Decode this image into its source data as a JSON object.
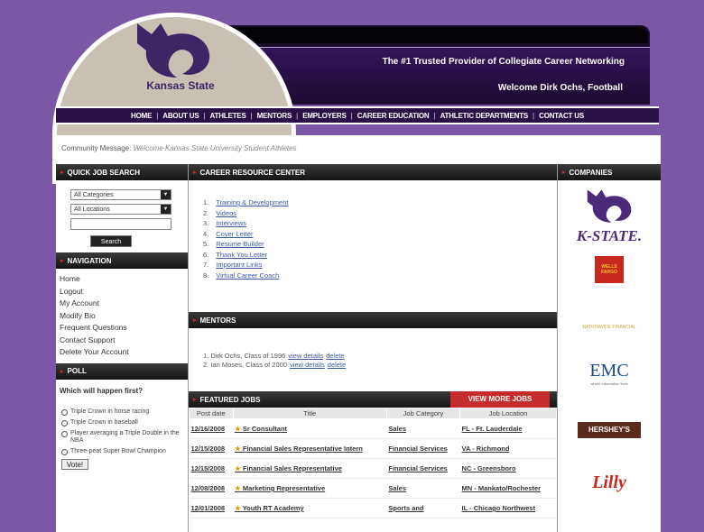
{
  "header": {
    "tagline": "The #1 Trusted Provider of Collegiate Career Networking",
    "welcome": "Welcome Dirk Ochs, Football",
    "logo_text": "Kansas State"
  },
  "nav": [
    "HOME",
    "ABOUT US",
    "ATHLETES",
    "MENTORS",
    "EMPLOYERS",
    "CAREER EDUCATION",
    "ATHLETIC DEPARTMENTS",
    "CONTACT US"
  ],
  "community": {
    "label": "Community Message:",
    "message": "Welcome Kansas State University Student Athletes"
  },
  "quick_search": {
    "title": "QUICK JOB SEARCH",
    "category": "All Categories",
    "location": "All Locations",
    "button": "Search"
  },
  "navigation": {
    "title": "NAVIGATION",
    "items": [
      "Home",
      "Logout",
      "My Account",
      "Modify Bio",
      "Frequent Questions",
      "Contact Support",
      "Delete Your Account"
    ]
  },
  "poll": {
    "title": "POLL",
    "question": "Which will happen first?",
    "options": [
      "Triple Crown in horse racing",
      "Triple Crown in baseball",
      "Player averaging a Triple Double in the NBA",
      "Three-peat Super Bowl Champion"
    ],
    "vote": "Vote!"
  },
  "career_center": {
    "title": "CAREER RESOURCE CENTER",
    "items": [
      "Training & Development",
      "Videos",
      "Interviews",
      "Cover Letter",
      "Resume Builder",
      "Thank You Letter",
      "Important Links",
      "Virtual Career Coach"
    ]
  },
  "mentors": {
    "title": "MENTORS",
    "items": [
      {
        "num": "1.",
        "text": "Dirk Ochs, Class of 1996",
        "view": "view details",
        "del": "delete"
      },
      {
        "num": "2.",
        "text": "Ian Moses, Class of 2000",
        "view": "view details",
        "del": "delete"
      }
    ]
  },
  "jobs": {
    "title": "FEATURED JOBS",
    "view_more": "VIEW MORE JOBS",
    "headers": [
      "Post date",
      "Title",
      "Job Category",
      "Job Location"
    ],
    "rows": [
      [
        "12/16/2008",
        "Sr Consultant",
        "Sales",
        "FL - Ft. Lauderdale"
      ],
      [
        "12/15/2008",
        "Financial Sales Representative Intern",
        "Financial Services",
        "VA - Richmond"
      ],
      [
        "12/15/2008",
        "Financial Sales Representative",
        "Financial Services",
        "NC - Greensboro"
      ],
      [
        "12/08/2008",
        "Marketing Representative",
        "Sales",
        "MN - Mankato/Rochester"
      ],
      [
        "12/01/2008",
        "Youth RT Academy",
        "Sports and",
        "IL - Chicago Northwest"
      ]
    ]
  },
  "companies": {
    "title": "COMPANIES",
    "kstate": "K-STATE.",
    "wf": "WELLS FARGO",
    "natl": "NATIONWIDE FINANCIAL",
    "emc": "EMC",
    "emc_sub": "where information lives",
    "hershey": "HERSHEY'S",
    "lilly": "Lilly"
  },
  "colors": {
    "background": "#7a58a6",
    "header": "#2a1048",
    "accent": "#c72c2c"
  }
}
